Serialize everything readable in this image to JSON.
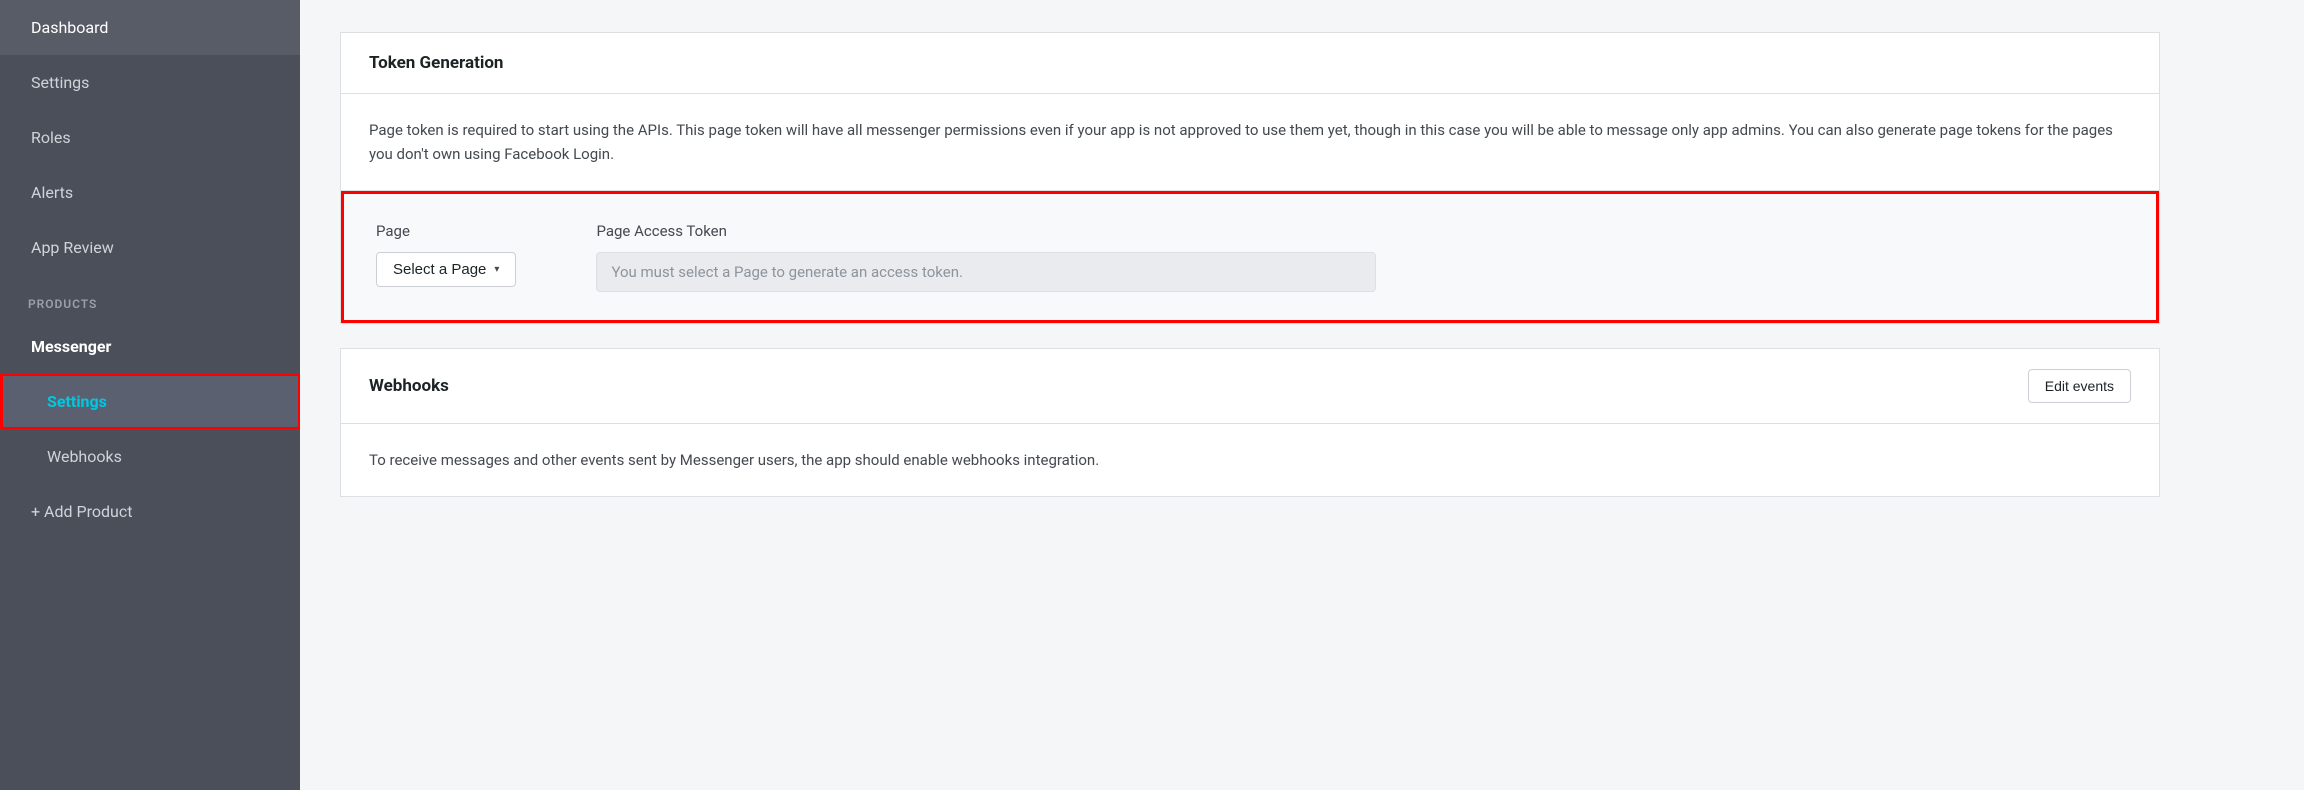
{
  "sidebar": {
    "items": [
      {
        "id": "dashboard",
        "label": "Dashboard",
        "active": false,
        "sub": false
      },
      {
        "id": "settings",
        "label": "Settings",
        "active": false,
        "sub": false
      },
      {
        "id": "roles",
        "label": "Roles",
        "active": false,
        "sub": false
      },
      {
        "id": "alerts",
        "label": "Alerts",
        "active": false,
        "sub": false
      },
      {
        "id": "app-review",
        "label": "App Review",
        "active": false,
        "sub": false
      }
    ],
    "products_label": "PRODUCTS",
    "products": [
      {
        "id": "messenger",
        "label": "Messenger",
        "active": false,
        "sub": false
      },
      {
        "id": "settings-sub",
        "label": "Settings",
        "active": true,
        "sub": true
      },
      {
        "id": "webhooks",
        "label": "Webhooks",
        "active": false,
        "sub": true
      },
      {
        "id": "add-product",
        "label": "+ Add Product",
        "active": false,
        "sub": false
      }
    ]
  },
  "token_generation": {
    "section_title": "Token Generation",
    "description": "Page token is required to start using the APIs. This page token will have all messenger permissions even if your app is not approved to use them yet, though in this case you will be able to message only app admins. You can also generate page tokens for the pages you don't own using Facebook Login.",
    "page_label": "Page",
    "select_page_btn": "Select a Page",
    "page_access_token_label": "Page Access Token",
    "token_placeholder": "You must select a Page to generate an access token."
  },
  "webhooks": {
    "section_title": "Webhooks",
    "edit_events_btn": "Edit events",
    "description": "To receive messages and other events sent by Messenger users, the app should enable webhooks integration."
  },
  "icons": {
    "chevron_down": "▾"
  }
}
